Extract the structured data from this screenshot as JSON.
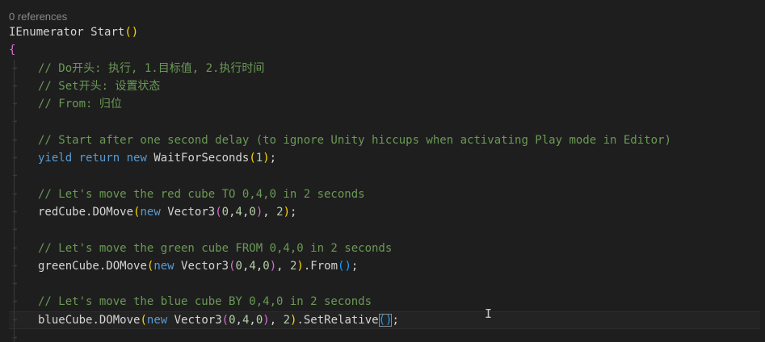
{
  "codelens": "0 references",
  "lines": [
    {
      "indent": false,
      "tokens": [
        {
          "t": "IEnumerator",
          "c": "pl"
        },
        {
          "t": " ",
          "c": "pl"
        },
        {
          "t": "Start",
          "c": "pl"
        },
        {
          "t": "()",
          "c": "br1"
        }
      ]
    },
    {
      "indent": false,
      "tokens": [
        {
          "t": "{",
          "c": "br2"
        }
      ]
    },
    {
      "indent": true,
      "tokens": [
        {
          "t": "// Do开头: 执行, 1.目标值, 2.执行时间",
          "c": "cm"
        }
      ]
    },
    {
      "indent": true,
      "tokens": [
        {
          "t": "// Set开头: 设置状态",
          "c": "cm"
        }
      ]
    },
    {
      "indent": true,
      "tokens": [
        {
          "t": "// From: 归位",
          "c": "cm"
        }
      ]
    },
    {
      "indent": true,
      "tokens": []
    },
    {
      "indent": true,
      "tokens": [
        {
          "t": "// Start after one second delay (to ignore Unity hiccups when activating Play mode in Editor)",
          "c": "cm"
        }
      ]
    },
    {
      "indent": true,
      "tokens": [
        {
          "t": "yield",
          "c": "kw"
        },
        {
          "t": " ",
          "c": "pl"
        },
        {
          "t": "return",
          "c": "kw"
        },
        {
          "t": " ",
          "c": "pl"
        },
        {
          "t": "new",
          "c": "kw"
        },
        {
          "t": " ",
          "c": "pl"
        },
        {
          "t": "WaitForSeconds",
          "c": "pl"
        },
        {
          "t": "(",
          "c": "br1"
        },
        {
          "t": "1",
          "c": "num"
        },
        {
          "t": ")",
          "c": "br1"
        },
        {
          "t": ";",
          "c": "pl"
        }
      ]
    },
    {
      "indent": true,
      "tokens": []
    },
    {
      "indent": true,
      "tokens": [
        {
          "t": "// Let's move the red cube TO 0,4,0 in 2 seconds",
          "c": "cm"
        }
      ]
    },
    {
      "indent": true,
      "tokens": [
        {
          "t": "redCube",
          "c": "pl"
        },
        {
          "t": ".",
          "c": "pl"
        },
        {
          "t": "DOMove",
          "c": "pl"
        },
        {
          "t": "(",
          "c": "br1"
        },
        {
          "t": "new",
          "c": "kw"
        },
        {
          "t": " ",
          "c": "pl"
        },
        {
          "t": "Vector3",
          "c": "pl"
        },
        {
          "t": "(",
          "c": "br2"
        },
        {
          "t": "0",
          "c": "num"
        },
        {
          "t": ",",
          "c": "pl"
        },
        {
          "t": "4",
          "c": "num"
        },
        {
          "t": ",",
          "c": "pl"
        },
        {
          "t": "0",
          "c": "num"
        },
        {
          "t": ")",
          "c": "br2"
        },
        {
          "t": ", ",
          "c": "pl"
        },
        {
          "t": "2",
          "c": "num"
        },
        {
          "t": ")",
          "c": "br1"
        },
        {
          "t": ";",
          "c": "pl"
        }
      ]
    },
    {
      "indent": true,
      "tokens": []
    },
    {
      "indent": true,
      "tokens": [
        {
          "t": "// Let's move the green cube FROM 0,4,0 in 2 seconds",
          "c": "cm"
        }
      ]
    },
    {
      "indent": true,
      "tokens": [
        {
          "t": "greenCube",
          "c": "pl"
        },
        {
          "t": ".",
          "c": "pl"
        },
        {
          "t": "DOMove",
          "c": "pl"
        },
        {
          "t": "(",
          "c": "br1"
        },
        {
          "t": "new",
          "c": "kw"
        },
        {
          "t": " ",
          "c": "pl"
        },
        {
          "t": "Vector3",
          "c": "pl"
        },
        {
          "t": "(",
          "c": "br2"
        },
        {
          "t": "0",
          "c": "num"
        },
        {
          "t": ",",
          "c": "pl"
        },
        {
          "t": "4",
          "c": "num"
        },
        {
          "t": ",",
          "c": "pl"
        },
        {
          "t": "0",
          "c": "num"
        },
        {
          "t": ")",
          "c": "br2"
        },
        {
          "t": ", ",
          "c": "pl"
        },
        {
          "t": "2",
          "c": "num"
        },
        {
          "t": ")",
          "c": "br1"
        },
        {
          "t": ".",
          "c": "pl"
        },
        {
          "t": "From",
          "c": "pl"
        },
        {
          "t": "()",
          "c": "br3"
        },
        {
          "t": ";",
          "c": "pl"
        }
      ]
    },
    {
      "indent": true,
      "tokens": []
    },
    {
      "indent": true,
      "tokens": [
        {
          "t": "// Let's move the blue cube BY 0,4,0 in 2 seconds",
          "c": "cm"
        }
      ]
    },
    {
      "indent": true,
      "current": true,
      "tokens": [
        {
          "t": "blueCube",
          "c": "pl"
        },
        {
          "t": ".",
          "c": "pl"
        },
        {
          "t": "DOMove",
          "c": "pl"
        },
        {
          "t": "(",
          "c": "br1"
        },
        {
          "t": "new",
          "c": "kw"
        },
        {
          "t": " ",
          "c": "pl"
        },
        {
          "t": "Vector3",
          "c": "pl"
        },
        {
          "t": "(",
          "c": "br2"
        },
        {
          "t": "0",
          "c": "num"
        },
        {
          "t": ",",
          "c": "pl"
        },
        {
          "t": "4",
          "c": "num"
        },
        {
          "t": ",",
          "c": "pl"
        },
        {
          "t": "0",
          "c": "num"
        },
        {
          "t": ")",
          "c": "br2"
        },
        {
          "t": ", ",
          "c": "pl"
        },
        {
          "t": "2",
          "c": "num"
        },
        {
          "t": ")",
          "c": "br1"
        },
        {
          "t": ".",
          "c": "pl"
        },
        {
          "t": "SetRelative",
          "c": "pl"
        },
        {
          "t": "()",
          "c": "br3",
          "match": true
        },
        {
          "t": ";",
          "c": "pl"
        }
      ]
    },
    {
      "indent": true,
      "tokens": []
    }
  ],
  "icons": {
    "whitespace": "tab-arrow-icon",
    "cursor": "text-cursor-icon"
  },
  "colors": {
    "background": "#1e1e1e",
    "comment": "#6a9955",
    "keyword": "#569cd6",
    "number": "#b5cea8",
    "text": "#d4d4d4",
    "bracket1": "#ffd700",
    "bracket2": "#da70d6",
    "bracket3": "#179fff"
  }
}
